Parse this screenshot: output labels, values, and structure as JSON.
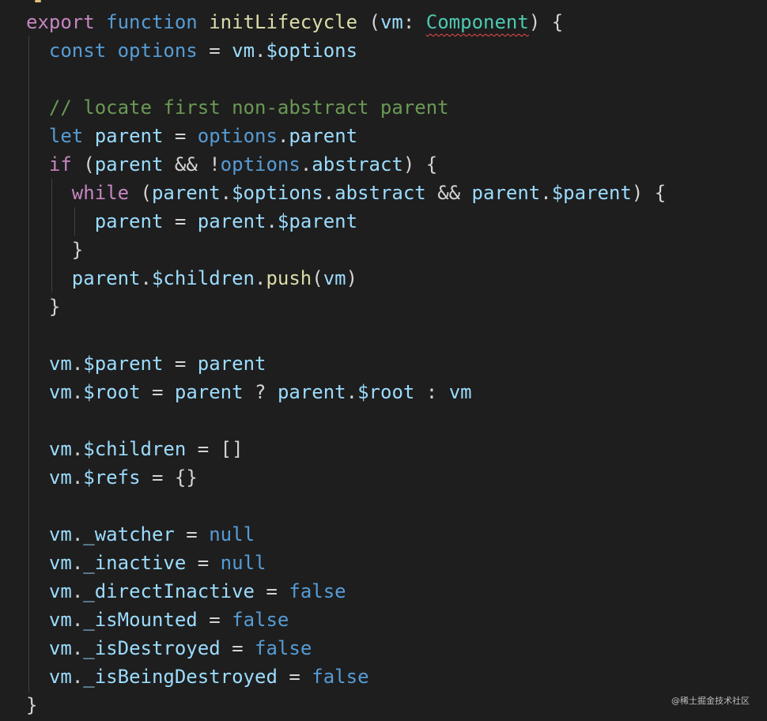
{
  "editor": {
    "lines": [
      [
        {
          "t": "export",
          "c": "kw"
        },
        {
          "t": " ",
          "c": "p"
        },
        {
          "t": "function",
          "c": "dec"
        },
        {
          "t": " ",
          "c": "p"
        },
        {
          "t": "initLifecycle",
          "c": "fname"
        },
        {
          "t": " (",
          "c": "p"
        },
        {
          "t": "vm",
          "c": "var"
        },
        {
          "t": ": ",
          "c": "p"
        },
        {
          "t": "Component",
          "c": "type"
        },
        {
          "t": ") {",
          "c": "p"
        }
      ],
      [
        {
          "t": "  ",
          "c": "p"
        },
        {
          "t": "const",
          "c": "dec"
        },
        {
          "t": " ",
          "c": "p"
        },
        {
          "t": "options",
          "c": "fn"
        },
        {
          "t": " = ",
          "c": "p"
        },
        {
          "t": "vm",
          "c": "var"
        },
        {
          "t": ".",
          "c": "p"
        },
        {
          "t": "$options",
          "c": "var"
        }
      ],
      [],
      [
        {
          "t": "  ",
          "c": "p"
        },
        {
          "t": "// locate first non-abstract parent",
          "c": "cm"
        }
      ],
      [
        {
          "t": "  ",
          "c": "p"
        },
        {
          "t": "let",
          "c": "dec"
        },
        {
          "t": " ",
          "c": "p"
        },
        {
          "t": "parent",
          "c": "var"
        },
        {
          "t": " = ",
          "c": "p"
        },
        {
          "t": "options",
          "c": "fn"
        },
        {
          "t": ".",
          "c": "p"
        },
        {
          "t": "parent",
          "c": "var"
        }
      ],
      [
        {
          "t": "  ",
          "c": "p"
        },
        {
          "t": "if",
          "c": "ctl"
        },
        {
          "t": " (",
          "c": "p"
        },
        {
          "t": "parent",
          "c": "var"
        },
        {
          "t": " && !",
          "c": "p"
        },
        {
          "t": "options",
          "c": "fn"
        },
        {
          "t": ".",
          "c": "p"
        },
        {
          "t": "abstract",
          "c": "var"
        },
        {
          "t": ") {",
          "c": "p"
        }
      ],
      [
        {
          "t": "    ",
          "c": "p"
        },
        {
          "t": "while",
          "c": "ctl"
        },
        {
          "t": " (",
          "c": "p"
        },
        {
          "t": "parent",
          "c": "var"
        },
        {
          "t": ".",
          "c": "p"
        },
        {
          "t": "$options",
          "c": "var"
        },
        {
          "t": ".",
          "c": "p"
        },
        {
          "t": "abstract",
          "c": "var"
        },
        {
          "t": " && ",
          "c": "p"
        },
        {
          "t": "parent",
          "c": "var"
        },
        {
          "t": ".",
          "c": "p"
        },
        {
          "t": "$parent",
          "c": "var"
        },
        {
          "t": ") {",
          "c": "p"
        }
      ],
      [
        {
          "t": "      ",
          "c": "p"
        },
        {
          "t": "parent",
          "c": "var"
        },
        {
          "t": " = ",
          "c": "p"
        },
        {
          "t": "parent",
          "c": "var"
        },
        {
          "t": ".",
          "c": "p"
        },
        {
          "t": "$parent",
          "c": "var"
        }
      ],
      [
        {
          "t": "    }",
          "c": "p"
        }
      ],
      [
        {
          "t": "    ",
          "c": "p"
        },
        {
          "t": "parent",
          "c": "var"
        },
        {
          "t": ".",
          "c": "p"
        },
        {
          "t": "$children",
          "c": "var"
        },
        {
          "t": ".",
          "c": "p"
        },
        {
          "t": "push",
          "c": "method"
        },
        {
          "t": "(",
          "c": "p"
        },
        {
          "t": "vm",
          "c": "var"
        },
        {
          "t": ")",
          "c": "p"
        }
      ],
      [
        {
          "t": "  }",
          "c": "p"
        }
      ],
      [],
      [
        {
          "t": "  ",
          "c": "p"
        },
        {
          "t": "vm",
          "c": "var"
        },
        {
          "t": ".",
          "c": "p"
        },
        {
          "t": "$parent",
          "c": "var"
        },
        {
          "t": " = ",
          "c": "p"
        },
        {
          "t": "parent",
          "c": "var"
        }
      ],
      [
        {
          "t": "  ",
          "c": "p"
        },
        {
          "t": "vm",
          "c": "var"
        },
        {
          "t": ".",
          "c": "p"
        },
        {
          "t": "$root",
          "c": "var"
        },
        {
          "t": " = ",
          "c": "p"
        },
        {
          "t": "parent",
          "c": "var"
        },
        {
          "t": " ? ",
          "c": "p"
        },
        {
          "t": "parent",
          "c": "var"
        },
        {
          "t": ".",
          "c": "p"
        },
        {
          "t": "$root",
          "c": "var"
        },
        {
          "t": " : ",
          "c": "p"
        },
        {
          "t": "vm",
          "c": "var"
        }
      ],
      [],
      [
        {
          "t": "  ",
          "c": "p"
        },
        {
          "t": "vm",
          "c": "var"
        },
        {
          "t": ".",
          "c": "p"
        },
        {
          "t": "$children",
          "c": "var"
        },
        {
          "t": " = []",
          "c": "p"
        }
      ],
      [
        {
          "t": "  ",
          "c": "p"
        },
        {
          "t": "vm",
          "c": "var"
        },
        {
          "t": ".",
          "c": "p"
        },
        {
          "t": "$refs",
          "c": "var"
        },
        {
          "t": " = {}",
          "c": "p"
        }
      ],
      [],
      [
        {
          "t": "  ",
          "c": "p"
        },
        {
          "t": "vm",
          "c": "var"
        },
        {
          "t": ".",
          "c": "p"
        },
        {
          "t": "_watcher",
          "c": "var"
        },
        {
          "t": " = ",
          "c": "p"
        },
        {
          "t": "null",
          "c": "lit"
        }
      ],
      [
        {
          "t": "  ",
          "c": "p"
        },
        {
          "t": "vm",
          "c": "var"
        },
        {
          "t": ".",
          "c": "p"
        },
        {
          "t": "_inactive",
          "c": "var"
        },
        {
          "t": " = ",
          "c": "p"
        },
        {
          "t": "null",
          "c": "lit"
        }
      ],
      [
        {
          "t": "  ",
          "c": "p"
        },
        {
          "t": "vm",
          "c": "var"
        },
        {
          "t": ".",
          "c": "p"
        },
        {
          "t": "_directInactive",
          "c": "var"
        },
        {
          "t": " = ",
          "c": "p"
        },
        {
          "t": "false",
          "c": "lit"
        }
      ],
      [
        {
          "t": "  ",
          "c": "p"
        },
        {
          "t": "vm",
          "c": "var"
        },
        {
          "t": ".",
          "c": "p"
        },
        {
          "t": "_isMounted",
          "c": "var"
        },
        {
          "t": " = ",
          "c": "p"
        },
        {
          "t": "false",
          "c": "lit"
        }
      ],
      [
        {
          "t": "  ",
          "c": "p"
        },
        {
          "t": "vm",
          "c": "var"
        },
        {
          "t": ".",
          "c": "p"
        },
        {
          "t": "_isDestroyed",
          "c": "var"
        },
        {
          "t": " = ",
          "c": "p"
        },
        {
          "t": "false",
          "c": "lit"
        }
      ],
      [
        {
          "t": "  ",
          "c": "p"
        },
        {
          "t": "vm",
          "c": "var"
        },
        {
          "t": ".",
          "c": "p"
        },
        {
          "t": "_isBeingDestroyed",
          "c": "var"
        },
        {
          "t": " = ",
          "c": "p"
        },
        {
          "t": "false",
          "c": "lit"
        }
      ],
      [
        {
          "t": "}",
          "c": "p"
        }
      ]
    ]
  },
  "watermark": {
    "text": "@稀土掘金技术社区"
  },
  "colors": {
    "background": "#1e1e1e",
    "keyword_purple": "#c586c0",
    "declaration_blue": "#569cd6",
    "function_yellow": "#dcdcaa",
    "variable_lightblue": "#9cdcfe",
    "type_teal": "#4ec9b0",
    "comment_green": "#6a9955",
    "error_underline_red": "#f14c4c"
  }
}
